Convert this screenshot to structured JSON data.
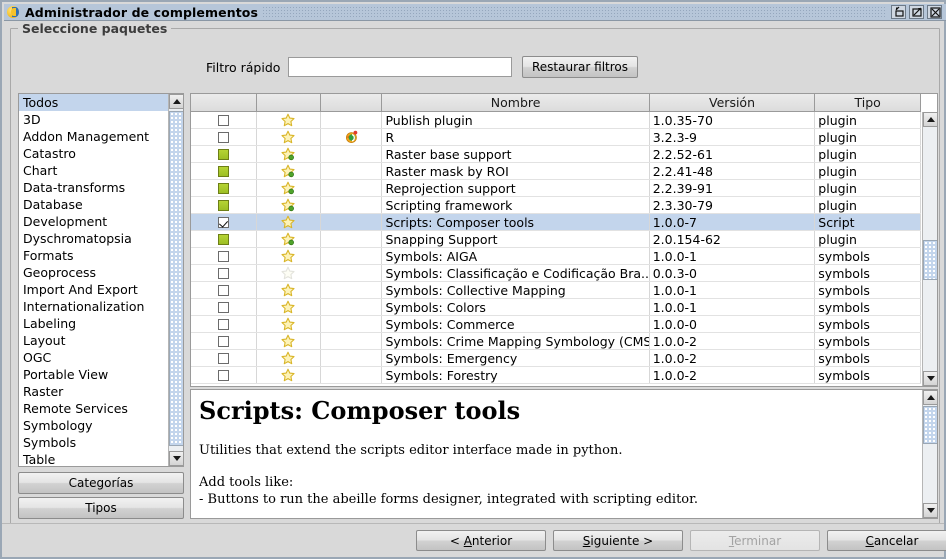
{
  "window": {
    "title": "Administrador de complementos",
    "icon": "gvsig-logo-icon",
    "buttons": {
      "minimize": "minimize-icon",
      "maximize": "maximize-icon",
      "close": "close-icon"
    }
  },
  "group": {
    "title": "Seleccione paquetes"
  },
  "filter": {
    "label": "Filtro rápido",
    "value": "",
    "placeholder": "",
    "reset_button": "Restaurar filtros"
  },
  "categories": {
    "items": [
      {
        "label": "Todos",
        "selected": true
      },
      {
        "label": "3D",
        "selected": false
      },
      {
        "label": "Addon Management",
        "selected": false
      },
      {
        "label": "Catastro",
        "selected": false
      },
      {
        "label": "Chart",
        "selected": false
      },
      {
        "label": "Data-transforms",
        "selected": false
      },
      {
        "label": "Database",
        "selected": false
      },
      {
        "label": "Development",
        "selected": false
      },
      {
        "label": "Dyschromatopsia",
        "selected": false
      },
      {
        "label": "Formats",
        "selected": false
      },
      {
        "label": "Geoprocess",
        "selected": false
      },
      {
        "label": "Import And Export",
        "selected": false
      },
      {
        "label": "Internationalization",
        "selected": false
      },
      {
        "label": "Labeling",
        "selected": false
      },
      {
        "label": "Layout",
        "selected": false
      },
      {
        "label": "OGC",
        "selected": false
      },
      {
        "label": "Portable View",
        "selected": false
      },
      {
        "label": "Raster",
        "selected": false
      },
      {
        "label": "Remote Services",
        "selected": false
      },
      {
        "label": "Symbology",
        "selected": false
      },
      {
        "label": "Symbols",
        "selected": false
      },
      {
        "label": "Table",
        "selected": false
      }
    ],
    "buttons": {
      "categories": "Categorías",
      "types": "Tipos"
    }
  },
  "table": {
    "headers": [
      "",
      "",
      "",
      "Nombre",
      "Versión",
      "Tipo"
    ],
    "rows": [
      {
        "check": "empty",
        "star": "star-outline",
        "extra": "",
        "name": "Publish plugin",
        "version": "1.0.35-70",
        "type": "plugin",
        "selected": false
      },
      {
        "check": "empty",
        "star": "star-outline",
        "extra": "r-icon",
        "name": "R",
        "version": "3.2.3-9",
        "type": "plugin",
        "selected": false
      },
      {
        "check": "green",
        "star": "star-dot",
        "extra": "",
        "name": "Raster base support",
        "version": "2.2.52-61",
        "type": "plugin",
        "selected": false
      },
      {
        "check": "green",
        "star": "star-dot",
        "extra": "",
        "name": "Raster mask by ROI",
        "version": "2.2.41-48",
        "type": "plugin",
        "selected": false
      },
      {
        "check": "green",
        "star": "star-dot",
        "extra": "",
        "name": "Reprojection support",
        "version": "2.2.39-91",
        "type": "plugin",
        "selected": false
      },
      {
        "check": "green",
        "star": "star-dot",
        "extra": "",
        "name": "Scripting framework",
        "version": "2.3.30-79",
        "type": "plugin",
        "selected": false
      },
      {
        "check": "checked",
        "star": "star-outline",
        "extra": "",
        "name": "Scripts: Composer tools",
        "version": "1.0.0-7",
        "type": "Script",
        "selected": true
      },
      {
        "check": "green",
        "star": "star-dot",
        "extra": "",
        "name": "Snapping Support",
        "version": "2.0.154-62",
        "type": "plugin",
        "selected": false
      },
      {
        "check": "empty",
        "star": "star-outline",
        "extra": "",
        "name": "Symbols: AIGA",
        "version": "1.0.0-1",
        "type": "symbols",
        "selected": false
      },
      {
        "check": "empty",
        "star": "star-pale",
        "extra": "",
        "name": "Symbols: Classificação e Codificação Bra...",
        "version": "0.0.3-0",
        "type": "symbols",
        "selected": false
      },
      {
        "check": "empty",
        "star": "star-outline",
        "extra": "",
        "name": "Symbols: Collective Mapping",
        "version": "1.0.0-1",
        "type": "symbols",
        "selected": false
      },
      {
        "check": "empty",
        "star": "star-outline",
        "extra": "",
        "name": "Symbols: Colors",
        "version": "1.0.0-1",
        "type": "symbols",
        "selected": false
      },
      {
        "check": "empty",
        "star": "star-outline",
        "extra": "",
        "name": "Symbols: Commerce",
        "version": "1.0.0-0",
        "type": "symbols",
        "selected": false
      },
      {
        "check": "empty",
        "star": "star-outline",
        "extra": "",
        "name": "Symbols: Crime Mapping Symbology (CMS)",
        "version": "1.0.0-2",
        "type": "symbols",
        "selected": false
      },
      {
        "check": "empty",
        "star": "star-outline",
        "extra": "",
        "name": "Symbols: Emergency",
        "version": "1.0.0-2",
        "type": "symbols",
        "selected": false
      },
      {
        "check": "empty",
        "star": "star-outline",
        "extra": "",
        "name": "Symbols: Forestry",
        "version": "1.0.0-2",
        "type": "symbols",
        "selected": false
      }
    ]
  },
  "description": {
    "title": "Scripts: Composer tools",
    "paragraph1": "Utilities that extend the scripts editor interface made in python.",
    "paragraph2": "Add tools like:",
    "paragraph3": "- Buttons to run the abeille forms designer, integrated with scripting editor."
  },
  "wizard": {
    "previous": "< Anterior",
    "next": "Siguiente >",
    "finish": "Terminar",
    "cancel": "Cancelar",
    "finish_enabled": false
  },
  "colors": {
    "titlebar": "#b6c6d9",
    "selection": "#c3d5ec",
    "check_green": "#b5d334",
    "panel": "#d9d9d9"
  }
}
